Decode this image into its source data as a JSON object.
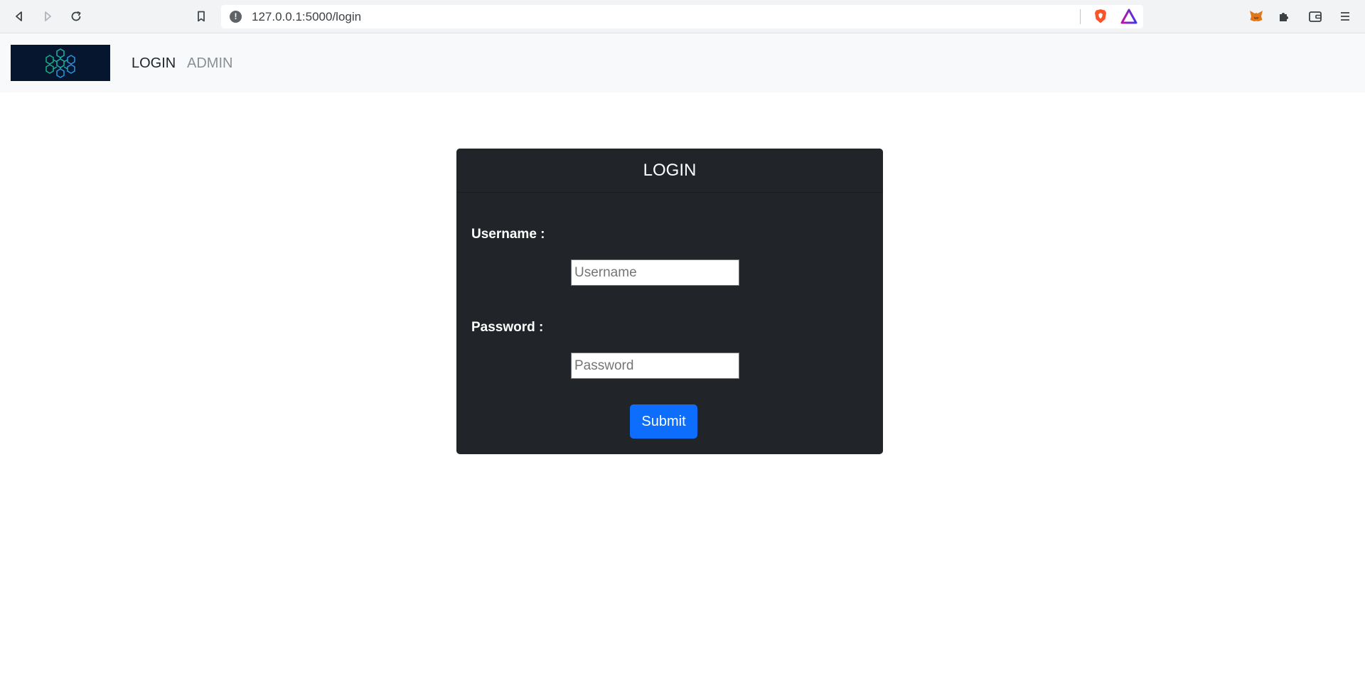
{
  "browser": {
    "url": "127.0.0.1:5000/login",
    "icons": [
      "back-icon",
      "forward-icon",
      "reload-icon",
      "bookmark-icon",
      "not-secure-icon",
      "brave-shields-icon",
      "brave-rewards-icon",
      "metamask-icon",
      "extensions-icon",
      "wallet-icon",
      "menu-icon"
    ]
  },
  "navbar": {
    "links": [
      {
        "label": "LOGIN",
        "state": "active"
      },
      {
        "label": "ADMIN",
        "state": "inactive"
      }
    ],
    "colors": {
      "background": "#f8f9fa",
      "logo_bg": "#06162e"
    }
  },
  "login_card": {
    "title": "LOGIN",
    "username_label": "Username :",
    "username_placeholder": "Username",
    "username_value": "",
    "password_label": "Password :",
    "password_placeholder": "Password",
    "password_value": "",
    "submit_label": "Submit",
    "colors": {
      "card_bg": "#212529",
      "button_bg": "#0d6efd"
    }
  }
}
